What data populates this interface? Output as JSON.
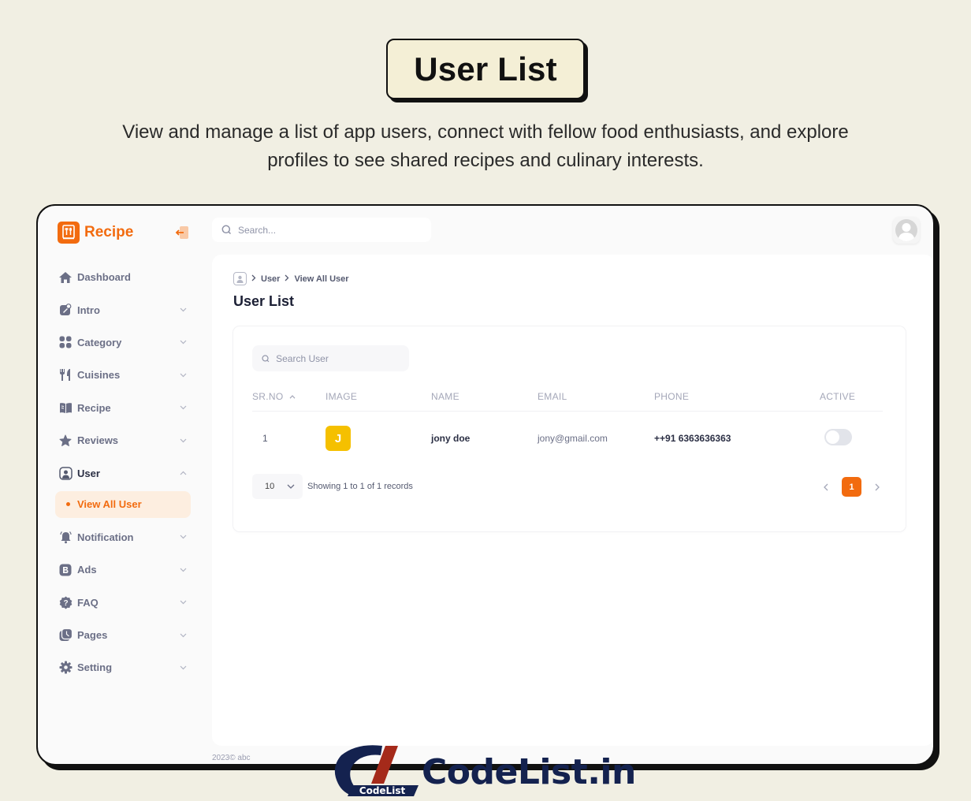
{
  "hero": {
    "title": "User List",
    "subtitle": "View and manage a list of app users, connect with fellow food enthusiasts, and explore profiles to see shared recipes and culinary interests."
  },
  "app": {
    "brand": "Recipe",
    "accent_color": "#f26b0f",
    "top_search_placeholder": "Search...",
    "footer": "2023©  abc"
  },
  "sidebar": {
    "items": [
      {
        "label": "Dashboard",
        "icon": "home-icon",
        "has_chevron": false
      },
      {
        "label": "Intro",
        "icon": "intro-icon",
        "has_chevron": true
      },
      {
        "label": "Category",
        "icon": "grid-icon",
        "has_chevron": true
      },
      {
        "label": "Cuisines",
        "icon": "fork-knife-icon",
        "has_chevron": true
      },
      {
        "label": "Recipe",
        "icon": "book-icon",
        "has_chevron": true
      },
      {
        "label": "Reviews",
        "icon": "star-icon",
        "has_chevron": true
      },
      {
        "label": "User",
        "icon": "user-icon",
        "has_chevron": true,
        "expanded": true
      },
      {
        "label": "Notification",
        "icon": "bell-icon",
        "has_chevron": true
      },
      {
        "label": "Ads",
        "icon": "ads-icon",
        "has_chevron": true
      },
      {
        "label": "FAQ",
        "icon": "question-icon",
        "has_chevron": true
      },
      {
        "label": "Pages",
        "icon": "pages-icon",
        "has_chevron": true
      },
      {
        "label": "Setting",
        "icon": "gear-icon",
        "has_chevron": true
      }
    ],
    "active_sub_item": "View All User"
  },
  "breadcrumb": [
    "User",
    "View All User"
  ],
  "page_title": "User List",
  "table": {
    "search_placeholder": "Search User",
    "columns": [
      "SR.NO",
      "IMAGE",
      "NAME",
      "EMAIL",
      "PHONE",
      "ACTIVE"
    ],
    "sort_column": "SR.NO",
    "sort_direction": "asc",
    "rows": [
      {
        "sr": "1",
        "image_initial": "J",
        "image_color": "#f5c000",
        "name": "jony doe",
        "email": "jony@gmail.com",
        "phone": "++91 6363636363",
        "active": false
      }
    ],
    "page_size": "10",
    "showing": "Showing 1 to 1 of 1 records",
    "current_page": "1"
  },
  "watermark": {
    "badge_text": "CodeList",
    "text": "CodeList.in"
  }
}
